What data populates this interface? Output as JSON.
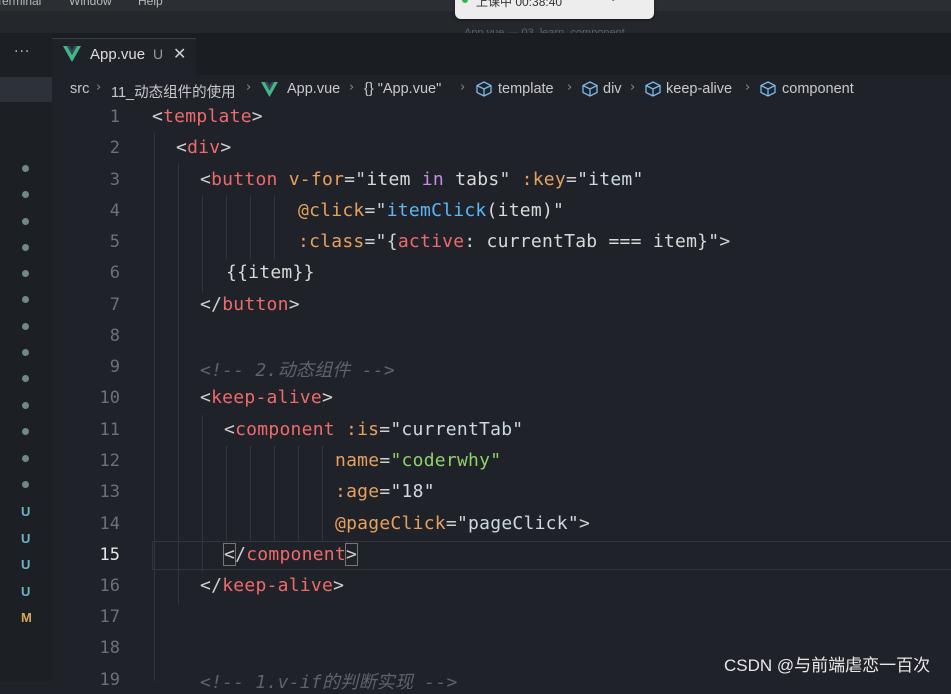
{
  "menubar": {
    "items": [
      "Terminal",
      "Window",
      "Help"
    ]
  },
  "recording": {
    "status": "上课中 00:38:40",
    "chevron": "⌄"
  },
  "window_title": "App.vue — 03_learn_component",
  "explorer": {
    "more": "···"
  },
  "scm_badges": [
    "U",
    "U",
    "U",
    "U",
    "M"
  ],
  "tab": {
    "label": "App.vue",
    "status": "U",
    "close": "✕"
  },
  "breadcrumb": {
    "src": "src",
    "folder": "11_动态组件的使用",
    "file": "App.vue",
    "object": "{} \"App.vue\"",
    "template": "template",
    "div": "div",
    "keepalive": "keep-alive",
    "component": "component",
    "sep": "›"
  },
  "line_numbers": [
    "1",
    "2",
    "3",
    "4",
    "5",
    "6",
    "7",
    "8",
    "9",
    "10",
    "11",
    "12",
    "13",
    "14",
    "15",
    "16",
    "17",
    "18",
    "19"
  ],
  "current_line": "15",
  "code": {
    "l1": {
      "open": "<",
      "tag": "template",
      "close": ">"
    },
    "l2": {
      "open": "<",
      "tag": "div",
      "close": ">"
    },
    "l3": {
      "open": "<",
      "tag": "button",
      "attr1": "v-for",
      "eq": "=",
      "q": "\"",
      "item": "item",
      "in": "in",
      "tabs": "tabs",
      "attr2": ":key",
      "val2": "\"item\""
    },
    "l4": {
      "attr": "@click",
      "eq": "=",
      "q": "\"",
      "fn": "itemClick",
      "args": "(item)"
    },
    "l5": {
      "attr": ":class",
      "eq": "=",
      "pre": "\"{",
      "active": "active",
      "rest": ": currentTab === item}\"",
      "close": ">"
    },
    "l6": {
      "text": "{{item}}"
    },
    "l7": {
      "open": "</",
      "tag": "button",
      "close": ">"
    },
    "l9": {
      "comment": "<!-- 2.动态组件 -->"
    },
    "l10": {
      "open": "<",
      "tag": "keep-alive",
      "close": ">"
    },
    "l11": {
      "open": "<",
      "tag": "component",
      "attr": ":is",
      "eq": "=",
      "val": "\"currentTab\""
    },
    "l12": {
      "attr": "name",
      "eq": "=",
      "val": "\"coderwhy\""
    },
    "l13": {
      "attr": ":age",
      "eq": "=",
      "val": "\"18\""
    },
    "l14": {
      "attr": "@pageClick",
      "eq": "=",
      "val": "\"pageClick\"",
      "close": ">"
    },
    "l15": {
      "open": "<",
      "slash": "/",
      "tag": "component",
      "close": ">"
    },
    "l16": {
      "open": "</",
      "tag": "keep-alive",
      "close": ">"
    },
    "l19": {
      "comment": "<!-- 1.v-if的判断实现 -->"
    }
  },
  "watermark": "CSDN @与前端虐恋一百次",
  "colors": {
    "tag": "#ef6a6a",
    "attribute": "#e7a05e",
    "keyword": "#c78be0",
    "function": "#5db6f2",
    "string_green": "#8fd16b",
    "vue_logo": "#41b883"
  }
}
